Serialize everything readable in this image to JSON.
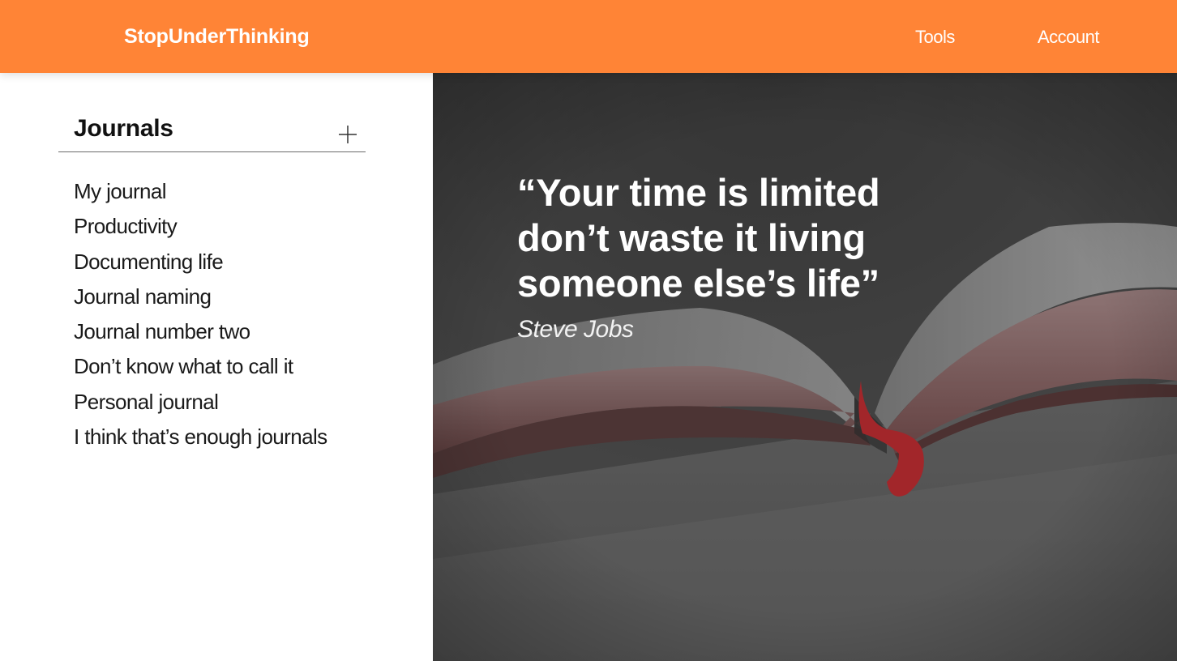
{
  "header": {
    "brand": "StopUnderThinking",
    "nav": {
      "tools": "Tools",
      "account": "Account"
    },
    "background_color": "#FF8436"
  },
  "sidebar": {
    "title": "Journals",
    "add_icon": "plus-icon",
    "journals": [
      "My journal",
      "Productivity",
      "Documenting life",
      "Journal naming",
      "Journal number two",
      "Don’t know what to call it",
      "Personal journal",
      "I think that’s enough journals"
    ]
  },
  "hero": {
    "quote_lines": [
      "“Your time is limited",
      "don’t waste it living",
      "someone else’s life”"
    ],
    "author": "Steve Jobs",
    "image": "open-book-photo"
  }
}
